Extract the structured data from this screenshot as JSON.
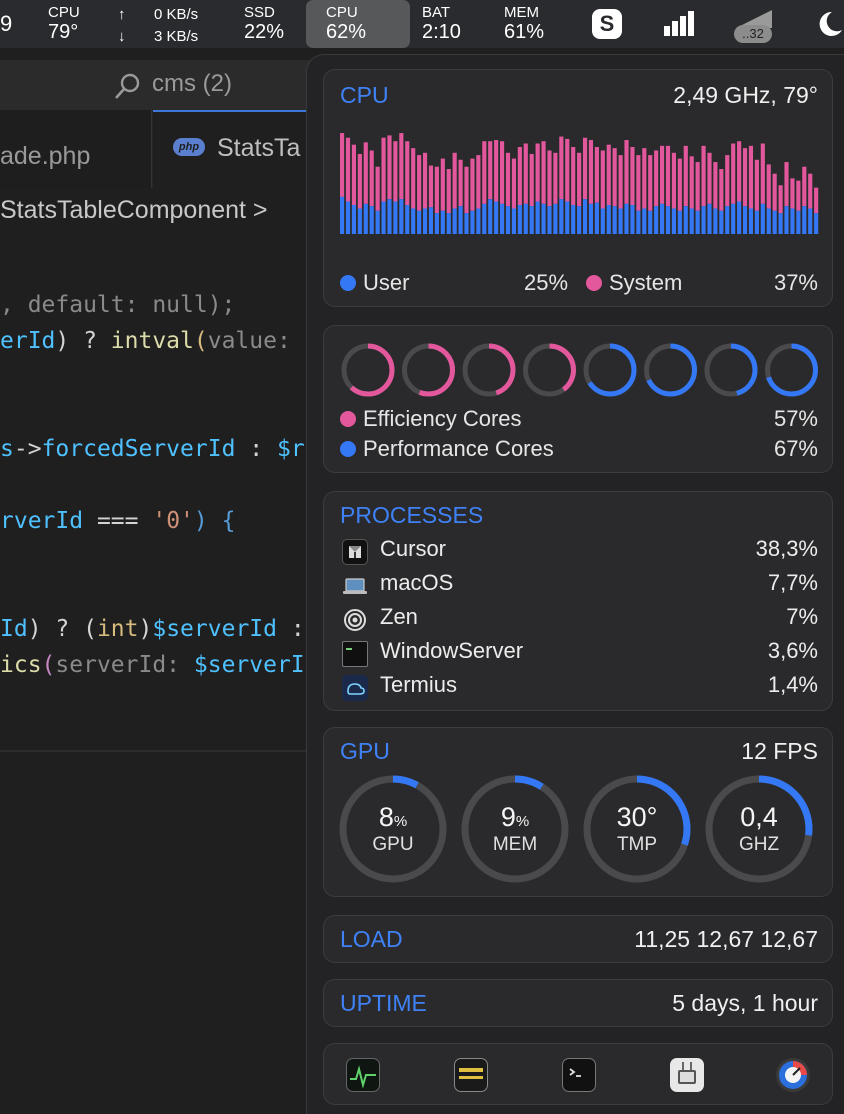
{
  "menubar": {
    "left_fragment": "9",
    "cpu": {
      "label": "CPU",
      "value": "79°"
    },
    "net": {
      "up_arrow": "↑",
      "up": "0 KB/s",
      "down_arrow": "↓",
      "down": "3 KB/s"
    },
    "ssd": {
      "label": "SSD",
      "value": "22%"
    },
    "cpu2": {
      "label": "CPU",
      "value": "62%"
    },
    "bat": {
      "label": "BAT",
      "value": "2:10"
    },
    "mem": {
      "label": "MEM",
      "value": "61%"
    },
    "skype_letter": "S",
    "badge": "..32"
  },
  "editor": {
    "search_title": "cms (2)",
    "tab1_label": "ade.php",
    "tab2_badge": "php",
    "tab2_label": "StatsTa",
    "breadcrumb": "StatsTableComponent >",
    "code": {
      "l1": ", default: null);",
      "l2a": "erId",
      "l2b": ") ? ",
      "l2c": "intval",
      "l2d": "(",
      "l2e": "value:",
      "l3a": "s",
      "l3b": "->",
      "l3c": "forcedServerId",
      "l3d": " : ",
      "l3e": "$r",
      "l4a": "rverId",
      "l4b": " === ",
      "l4c": "'0'",
      "l4d": ") {",
      "l5a": "Id",
      "l5b": ") ? (",
      "l5c": "int",
      "l5d": ")",
      "l5e": "$serverId",
      "l5f": " :",
      "l6a": "ics",
      "l6b": "(",
      "l6c": "serverId:",
      "l6d": " $serverI"
    }
  },
  "popup": {
    "cpu": {
      "title": "CPU",
      "freq": "2,49 GHz, 79°",
      "user_label": "User",
      "user_value": "25%",
      "system_label": "System",
      "system_value": "37%",
      "colors": {
        "user": "#3478f6",
        "system": "#e3589c"
      },
      "history": [
        [
          0.32,
          0.55
        ],
        [
          0.28,
          0.55
        ],
        [
          0.25,
          0.52
        ],
        [
          0.22,
          0.47
        ],
        [
          0.26,
          0.53
        ],
        [
          0.24,
          0.48
        ],
        [
          0.2,
          0.38
        ],
        [
          0.28,
          0.55
        ],
        [
          0.3,
          0.55
        ],
        [
          0.28,
          0.52
        ],
        [
          0.3,
          0.57
        ],
        [
          0.25,
          0.55
        ],
        [
          0.22,
          0.52
        ],
        [
          0.2,
          0.48
        ],
        [
          0.22,
          0.48
        ],
        [
          0.23,
          0.36
        ],
        [
          0.18,
          0.4
        ],
        [
          0.2,
          0.45
        ],
        [
          0.18,
          0.38
        ],
        [
          0.22,
          0.48
        ],
        [
          0.24,
          0.4
        ],
        [
          0.18,
          0.4
        ],
        [
          0.2,
          0.45
        ],
        [
          0.22,
          0.46
        ],
        [
          0.26,
          0.54
        ],
        [
          0.3,
          0.5
        ],
        [
          0.28,
          0.53
        ],
        [
          0.26,
          0.54
        ],
        [
          0.24,
          0.46
        ],
        [
          0.22,
          0.43
        ],
        [
          0.25,
          0.5
        ],
        [
          0.26,
          0.52
        ],
        [
          0.24,
          0.45
        ],
        [
          0.28,
          0.5
        ],
        [
          0.26,
          0.54
        ],
        [
          0.24,
          0.48
        ],
        [
          0.26,
          0.44
        ],
        [
          0.3,
          0.54
        ],
        [
          0.28,
          0.54
        ],
        [
          0.25,
          0.5
        ],
        [
          0.24,
          0.46
        ],
        [
          0.3,
          0.53
        ],
        [
          0.26,
          0.55
        ],
        [
          0.27,
          0.48
        ],
        [
          0.22,
          0.5
        ],
        [
          0.25,
          0.52
        ],
        [
          0.24,
          0.5
        ],
        [
          0.22,
          0.46
        ],
        [
          0.26,
          0.55
        ],
        [
          0.25,
          0.5
        ],
        [
          0.2,
          0.48
        ],
        [
          0.22,
          0.52
        ],
        [
          0.2,
          0.48
        ],
        [
          0.24,
          0.48
        ],
        [
          0.26,
          0.5
        ],
        [
          0.24,
          0.52
        ],
        [
          0.22,
          0.48
        ],
        [
          0.2,
          0.45
        ],
        [
          0.24,
          0.52
        ],
        [
          0.22,
          0.45
        ],
        [
          0.2,
          0.42
        ],
        [
          0.24,
          0.52
        ],
        [
          0.26,
          0.44
        ],
        [
          0.22,
          0.4
        ],
        [
          0.2,
          0.36
        ],
        [
          0.24,
          0.44
        ],
        [
          0.26,
          0.52
        ],
        [
          0.28,
          0.52
        ],
        [
          0.24,
          0.5
        ],
        [
          0.22,
          0.54
        ],
        [
          0.2,
          0.44
        ],
        [
          0.26,
          0.52
        ],
        [
          0.22,
          0.38
        ],
        [
          0.2,
          0.32
        ],
        [
          0.18,
          0.24
        ],
        [
          0.24,
          0.38
        ],
        [
          0.22,
          0.26
        ],
        [
          0.2,
          0.26
        ],
        [
          0.24,
          0.34
        ],
        [
          0.22,
          0.3
        ],
        [
          0.18,
          0.22
        ]
      ]
    },
    "cores": {
      "efficiency_label": "Efficiency Cores",
      "efficiency_value": "57%",
      "performance_label": "Performance Cores",
      "performance_value": "67%",
      "rings": [
        {
          "type": "efficiency",
          "load": 0.62
        },
        {
          "type": "efficiency",
          "load": 0.56
        },
        {
          "type": "efficiency",
          "load": 0.45
        },
        {
          "type": "efficiency",
          "load": 0.4
        },
        {
          "type": "performance",
          "load": 0.66
        },
        {
          "type": "performance",
          "load": 0.68
        },
        {
          "type": "performance",
          "load": 0.46
        },
        {
          "type": "performance",
          "load": 0.7
        }
      ]
    },
    "processes": {
      "title": "PROCESSES",
      "items": [
        {
          "name": "Cursor",
          "value": "38,3%",
          "icon": "cursor-icon"
        },
        {
          "name": "macOS",
          "value": "7,7%",
          "icon": "laptop-icon"
        },
        {
          "name": "Zen",
          "value": "7%",
          "icon": "zen-icon"
        },
        {
          "name": "WindowServer",
          "value": "3,6%",
          "icon": "window-server-icon"
        },
        {
          "name": "Termius",
          "value": "1,4%",
          "icon": "termius-icon"
        }
      ]
    },
    "gpu": {
      "title": "GPU",
      "fps": "12 FPS",
      "gauges": [
        {
          "value": "8",
          "unit": "%",
          "label": "GPU",
          "fill": 0.08
        },
        {
          "value": "9",
          "unit": "%",
          "label": "MEM",
          "fill": 0.09
        },
        {
          "value": "30°",
          "unit": "",
          "label": "TMP",
          "fill": 0.3
        },
        {
          "value": "0,4",
          "unit": "",
          "label": "GHZ",
          "fill": 0.27
        }
      ]
    },
    "load": {
      "title": "LOAD",
      "value": "11,25 12,67 12,67"
    },
    "uptime": {
      "title": "UPTIME",
      "value": "5 days, 1 hour"
    },
    "toolbar": [
      "activity-monitor-icon",
      "console-icon",
      "terminal-icon",
      "system-information-icon",
      "stats-icon"
    ]
  }
}
